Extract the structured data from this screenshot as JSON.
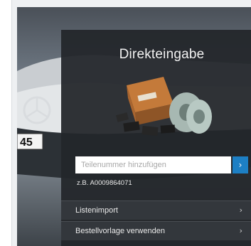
{
  "panel": {
    "title": "Direkteingabe",
    "image_icon": "brake-parts-image"
  },
  "search": {
    "placeholder": "Teilenummer hinzufügen",
    "value": "",
    "button_icon": "chevron-right-icon",
    "button_glyph": "›",
    "example": "z.B. A0009864071"
  },
  "menu": {
    "items": [
      {
        "label": "Listenimport",
        "chevron": "›"
      },
      {
        "label": "Bestellvorlage verwenden",
        "chevron": "›"
      }
    ]
  },
  "background": {
    "plate_text": "45"
  },
  "colors": {
    "panel_bg": "#23262a",
    "accent": "#1d7fc4",
    "text": "#ffffff"
  }
}
